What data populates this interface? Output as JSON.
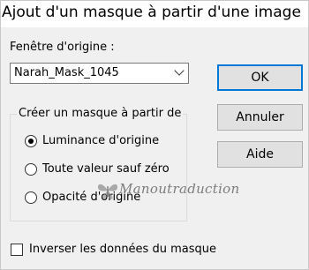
{
  "window": {
    "title": "Ajout d'un masque à partir d'une image"
  },
  "source": {
    "label": "Fenêtre d'origine :",
    "selected": "Narah_Mask_1045"
  },
  "buttons": {
    "ok": "OK",
    "cancel": "Annuler",
    "help": "Aide"
  },
  "group": {
    "legend": "Créer un masque à partir de",
    "options": [
      {
        "label": "Luminance d'origine",
        "checked": true
      },
      {
        "label": "Toute valeur sauf zéro",
        "checked": false
      },
      {
        "label": "Opacité d'origine",
        "checked": false
      }
    ]
  },
  "invert": {
    "label": "Inverser les données du masque",
    "checked": false
  },
  "watermark": {
    "text": "Manoutraduction"
  },
  "colors": {
    "accent": "#0078d7",
    "dialog_bg": "#f0f0f0",
    "button_bg": "#e1e1e1"
  }
}
